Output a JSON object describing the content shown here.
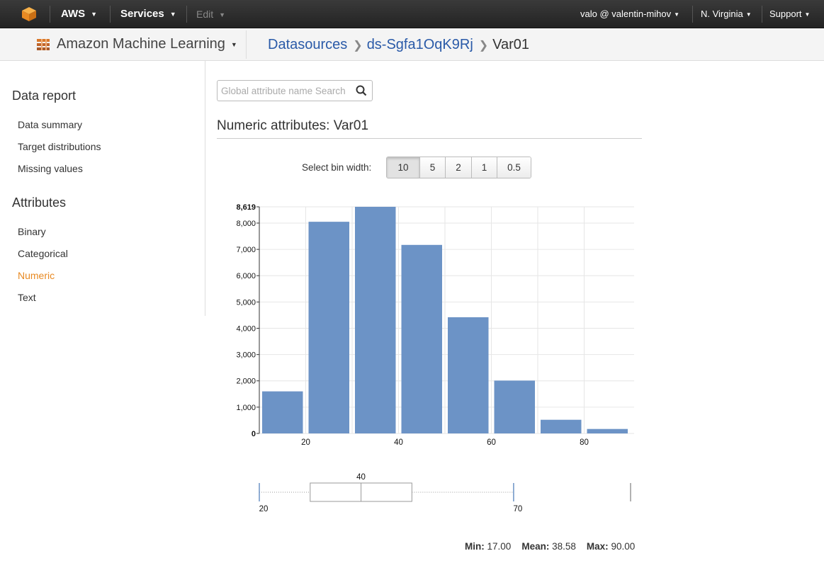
{
  "topbar": {
    "aws": "AWS",
    "services": "Services",
    "edit": "Edit",
    "account": "valo @ valentin-mihov",
    "region": "N. Virginia",
    "support": "Support"
  },
  "subbar": {
    "service_name": "Amazon Machine Learning",
    "breadcrumbs": [
      "Datasources",
      "ds-Sgfa1OqK9Rj",
      "Var01"
    ]
  },
  "sidebar": {
    "data_report_heading": "Data report",
    "data_report_items": [
      "Data summary",
      "Target distributions",
      "Missing values"
    ],
    "attributes_heading": "Attributes",
    "attribute_items": [
      "Binary",
      "Categorical",
      "Numeric",
      "Text"
    ],
    "active_item": "Numeric"
  },
  "search": {
    "placeholder": "Global attribute name Search"
  },
  "section_title": "Numeric attributes: Var01",
  "bin_selector": {
    "label": "Select bin width:",
    "options": [
      "10",
      "5",
      "2",
      "1",
      "0.5"
    ],
    "selected": "10"
  },
  "colors": {
    "bar": "#6c93c6",
    "accent": "#e88a23",
    "link": "#2a5aa8"
  },
  "chart_data": {
    "type": "bar",
    "bins": [
      {
        "x0": 10,
        "x1": 20,
        "value": 1600
      },
      {
        "x0": 20,
        "x1": 30,
        "value": 8050
      },
      {
        "x0": 30,
        "x1": 40,
        "value": 8619
      },
      {
        "x0": 40,
        "x1": 50,
        "value": 7170
      },
      {
        "x0": 50,
        "x1": 60,
        "value": 4420
      },
      {
        "x0": 60,
        "x1": 70,
        "value": 2010
      },
      {
        "x0": 70,
        "x1": 80,
        "value": 520
      },
      {
        "x0": 80,
        "x1": 90,
        "value": 170
      }
    ],
    "xlim": [
      10,
      90
    ],
    "ylim": [
      0,
      8619
    ],
    "xticks": [
      20,
      40,
      60,
      80
    ],
    "yticks": [
      0,
      1000,
      2000,
      3000,
      4000,
      5000,
      6000,
      7000,
      8000,
      8619
    ],
    "ytick_labels": [
      "0",
      "1,000",
      "2,000",
      "3,000",
      "4,000",
      "5,000",
      "6,000",
      "7,000",
      "8,000",
      "8,619"
    ],
    "grid": true,
    "boxplot": {
      "range": [
        17,
        90
      ],
      "whisker_low": 17,
      "q1": 27,
      "median": 37,
      "q3": 47,
      "whisker_high": 67,
      "labels": [
        {
          "pos": 37,
          "text": "40",
          "where": "top"
        },
        {
          "pos": 17,
          "text": "20",
          "where": "bottom"
        },
        {
          "pos": 67,
          "text": "70",
          "where": "bottom"
        }
      ]
    }
  },
  "stats": {
    "min_label": "Min:",
    "min": "17.00",
    "mean_label": "Mean:",
    "mean": "38.58",
    "max_label": "Max:",
    "max": "90.00"
  }
}
